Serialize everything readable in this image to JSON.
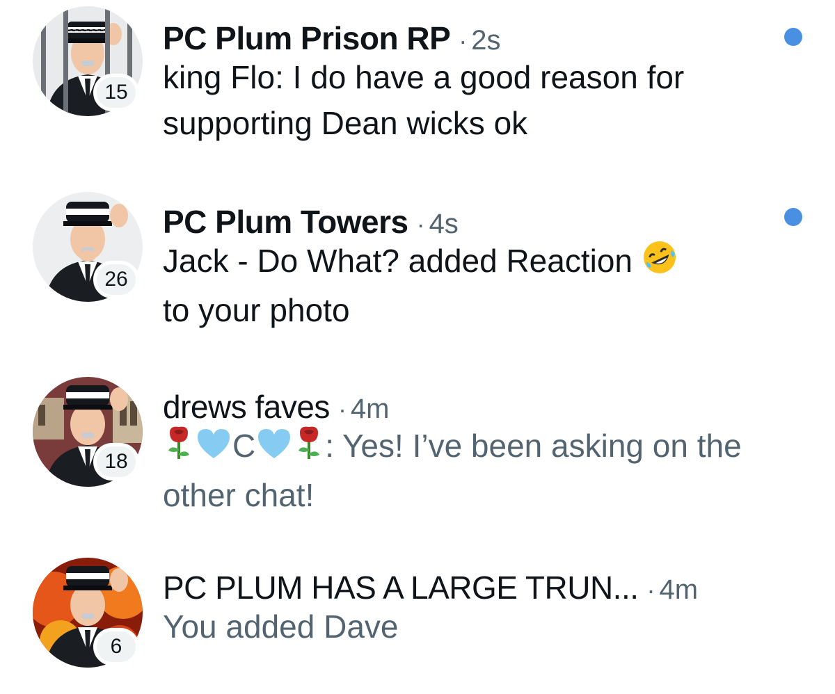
{
  "conversations": [
    {
      "name": "PC Plum Prison RP",
      "separator": "·",
      "time": "2s",
      "preview": "king Flo: I do have a good reason for supporting Dean wicks ok",
      "badge": "15",
      "unread": true,
      "avatar_icon": "police-officer-behind-bars-avatar"
    },
    {
      "name": "PC Plum Towers",
      "separator": "·",
      "time": "4s",
      "preview_before_emoji": "Jack - Do What? added Reaction",
      "preview_emoji": "rolling-on-floor-laughing-emoji",
      "preview_after_emoji": "to your photo",
      "badge": "26",
      "unread": true,
      "avatar_icon": "police-officer-avatar"
    },
    {
      "name": "drews faves",
      "separator": "·",
      "time": "4m",
      "preview_emojis": [
        "rose-emoji",
        "light-blue-heart-emoji"
      ],
      "preview_letter": "C",
      "preview_text": ": Yes! I’ve been asking on the other chat!",
      "badge": "18",
      "unread": false,
      "avatar_icon": "police-officer-church-avatar"
    },
    {
      "name": "PC PLUM HAS A LARGE TRUN...",
      "separator": "·",
      "time": "4m",
      "preview": "You added Dave",
      "badge": "6",
      "unread": false,
      "avatar_icon": "police-officer-fire-avatar"
    }
  ],
  "colors": {
    "unread_dot": "#4a90e2",
    "primary_text": "#0f1419",
    "secondary_text": "#536471",
    "badge_bg": "#eff3f4"
  }
}
